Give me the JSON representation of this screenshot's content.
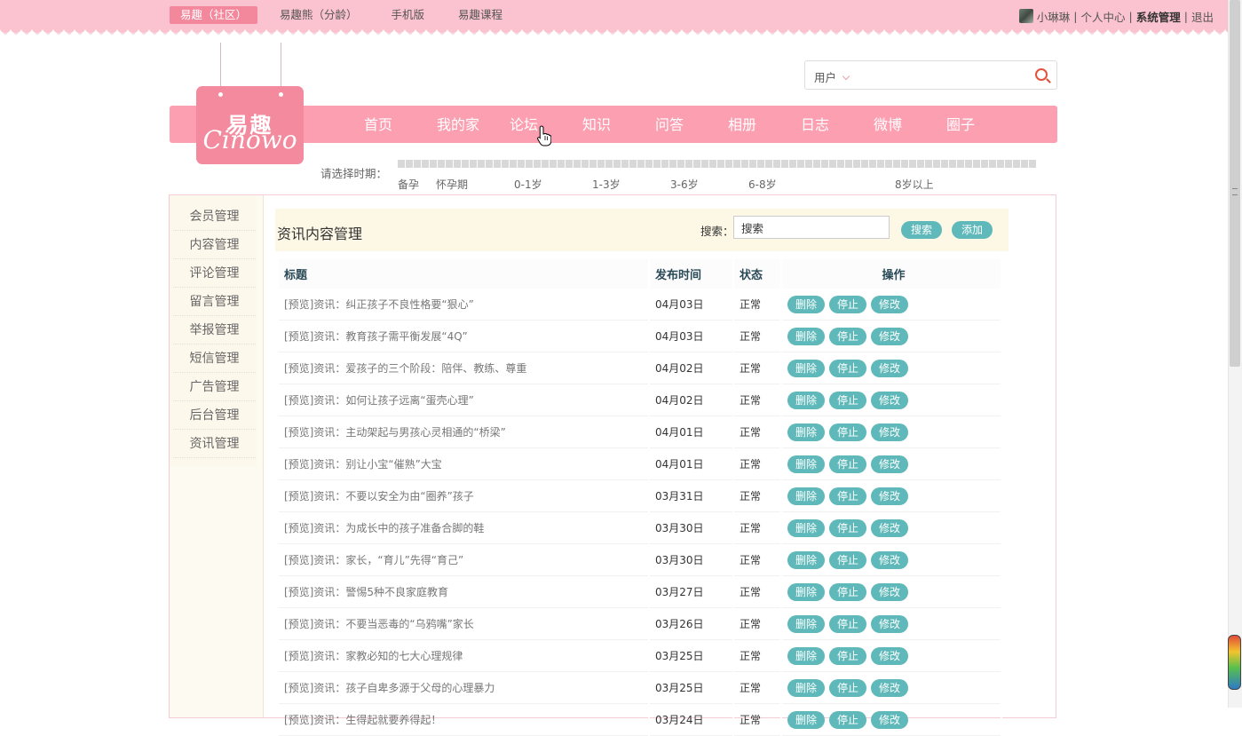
{
  "top_nav": {
    "links": [
      "易趣（社区）",
      "易趣熊（分龄）",
      "手机版",
      "易趣课程"
    ],
    "active_index": 0
  },
  "user_bar": {
    "username": "小琳琳",
    "sep": "|",
    "personal_center": "个人中心",
    "system_admin": "系统管理",
    "logout": "退出"
  },
  "search": {
    "category": "用户",
    "icon": "search-icon"
  },
  "logo": {
    "cn": "易趣",
    "en": "Cinowo"
  },
  "main_nav": [
    "首页",
    "我的家",
    "论坛",
    "知识",
    "问答",
    "相册",
    "日志",
    "微博",
    "圈子"
  ],
  "age_selector": {
    "label": "请选择时期：",
    "ticks": [
      "备孕",
      "怀孕期",
      "0-1岁",
      "1-3岁",
      "3-6岁",
      "6-8岁",
      "8岁以上"
    ]
  },
  "sidebar": [
    "会员管理",
    "内容管理",
    "评论管理",
    "留言管理",
    "举报管理",
    "短信管理",
    "广告管理",
    "后台管理",
    "资讯管理"
  ],
  "content": {
    "title": "资讯内容管理",
    "search_label": "搜索：",
    "search_value": "搜索",
    "search_button": "搜索",
    "add_button": "添加"
  },
  "table": {
    "headers": [
      "标题",
      "发布时间",
      "状态",
      "操作"
    ],
    "actions": [
      "删除",
      "停止",
      "修改"
    ],
    "rows": [
      {
        "title": "[预览]资讯：纠正孩子不良性格要“狠心”",
        "date": "04月03日",
        "status": "正常"
      },
      {
        "title": "[预览]资讯：教育孩子需平衡发展“4Q”",
        "date": "04月03日",
        "status": "正常"
      },
      {
        "title": "[预览]资讯：爱孩子的三个阶段：陪伴、教练、尊重",
        "date": "04月02日",
        "status": "正常"
      },
      {
        "title": "[预览]资讯：如何让孩子远离“蛋壳心理”",
        "date": "04月02日",
        "status": "正常"
      },
      {
        "title": "[预览]资讯：主动架起与男孩心灵相通的“桥梁”",
        "date": "04月01日",
        "status": "正常"
      },
      {
        "title": "[预览]资讯：别让小宝“催熟”大宝",
        "date": "04月01日",
        "status": "正常"
      },
      {
        "title": "[预览]资讯：不要以安全为由“圈养”孩子",
        "date": "03月31日",
        "status": "正常"
      },
      {
        "title": "[预览]资讯：为成长中的孩子准备合脚的鞋",
        "date": "03月30日",
        "status": "正常"
      },
      {
        "title": "[预览]资讯：家长，“育儿”先得“育己”",
        "date": "03月30日",
        "status": "正常"
      },
      {
        "title": "[预览]资讯：警惕5种不良家庭教育",
        "date": "03月27日",
        "status": "正常"
      },
      {
        "title": "[预览]资讯：不要当恶毒的“乌鸦嘴”家长",
        "date": "03月26日",
        "status": "正常"
      },
      {
        "title": "[预览]资讯：家教必知的七大心理规律",
        "date": "03月25日",
        "status": "正常"
      },
      {
        "title": "[预览]资讯：孩子自卑多源于父母的心理暴力",
        "date": "03月25日",
        "status": "正常"
      },
      {
        "title": "[预览]资讯：生得起就要养得起！",
        "date": "03月24日",
        "status": "正常"
      }
    ]
  },
  "colors": {
    "topbar": "#fbc3cf",
    "navbar": "#fc9fb1",
    "logo": "#f38a9d",
    "action_button": "#5fb8b9",
    "active_toplink": "#f3879c"
  }
}
